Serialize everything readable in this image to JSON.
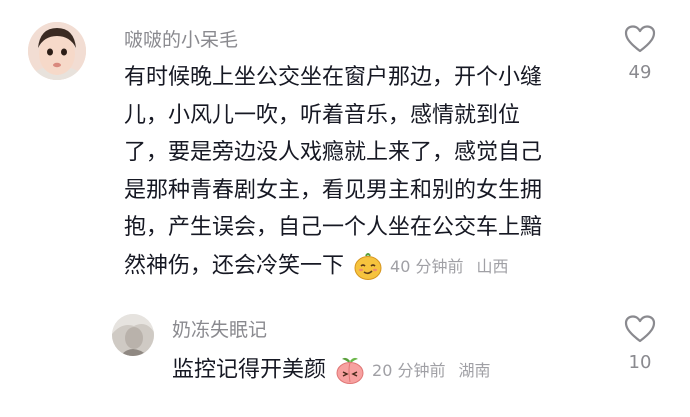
{
  "comments": [
    {
      "username": "啵啵的小呆毛",
      "lines": [
        "有时候晚上坐公交坐在窗户那边，开个小缝",
        "儿，小风儿一吹，听着音乐，感情就到位",
        "了，要是旁边没人戏瘾就上来了，感觉自己",
        "是那种青春剧女主，看见男主和别的女生拥",
        "抱，产生误会，自己一个人坐在公交车上黯",
        "然神伤，还会冷笑一下"
      ],
      "sticker": "smirking-face-sticker",
      "time": "40 分钟前",
      "location": "山西",
      "likes": "49"
    },
    {
      "username": "奶冻失眠记",
      "text": "监控记得开美颜",
      "sticker": "peach-face-sticker",
      "time": "20 分钟前",
      "location": "湖南",
      "likes": "10"
    }
  ],
  "colors": {
    "username": "#8a8a8f",
    "text": "#161823",
    "meta": "#a0a0a5",
    "background": "#ffffff"
  },
  "icons": {
    "like": "heart-outline-icon"
  }
}
